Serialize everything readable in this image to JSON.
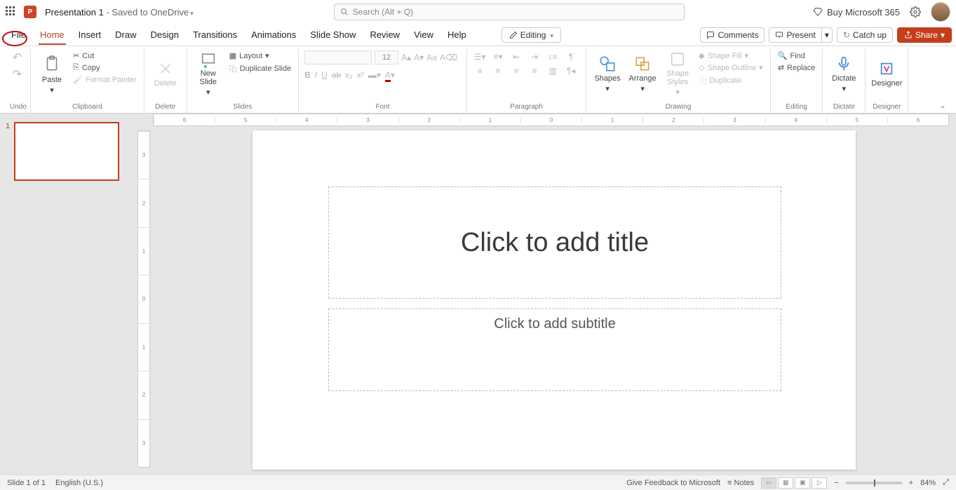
{
  "title": {
    "name": "Presentation 1",
    "suffix": " - Saved to OneDrive"
  },
  "search": {
    "placeholder": "Search (Alt + Q)"
  },
  "header": {
    "buy": "Buy Microsoft 365"
  },
  "tabs": {
    "file": "File",
    "home": "Home",
    "insert": "Insert",
    "draw": "Draw",
    "design": "Design",
    "transitions": "Transitions",
    "animations": "Animations",
    "slideshow": "Slide Show",
    "review": "Review",
    "view": "View",
    "help": "Help"
  },
  "mode": {
    "editing": "Editing",
    "comments": "Comments",
    "present": "Present",
    "catchup": "Catch up",
    "share": "Share"
  },
  "ribbon": {
    "undo": "Undo",
    "clipboard": {
      "paste": "Paste",
      "cut": "Cut",
      "copy": "Copy",
      "format_painter": "Format Painter",
      "label": "Clipboard"
    },
    "delete": {
      "btn": "Delete",
      "label": "Delete"
    },
    "slides": {
      "new": "New\nSlide",
      "layout": "Layout",
      "duplicate": "Duplicate Slide",
      "label": "Slides"
    },
    "font": {
      "size": "12",
      "label": "Font"
    },
    "paragraph": {
      "label": "Paragraph"
    },
    "drawing": {
      "shapes": "Shapes",
      "arrange": "Arrange",
      "styles": "Shape\nStyles",
      "fill": "Shape Fill",
      "outline": "Shape Outline",
      "dup": "Duplicate",
      "label": "Drawing"
    },
    "editing": {
      "find": "Find",
      "replace": "Replace",
      "label": "Editing"
    },
    "dictate": {
      "btn": "Dictate",
      "label": "Dictate"
    },
    "designer": {
      "btn": "Designer",
      "label": "Designer"
    }
  },
  "thumbs": {
    "n1": "1"
  },
  "slide": {
    "title_ph": "Click to add title",
    "sub_ph": "Click to add subtitle"
  },
  "status": {
    "slide": "Slide 1 of 1",
    "lang": "English (U.S.)",
    "feedback": "Give Feedback to Microsoft",
    "notes": "Notes",
    "zoom": "84%",
    "minus": "−",
    "plus": "+"
  },
  "ruler_h": [
    "6",
    "5",
    "4",
    "3",
    "2",
    "1",
    "0",
    "1",
    "2",
    "3",
    "4",
    "5",
    "6"
  ],
  "ruler_v": [
    "3",
    "2",
    "1",
    "0",
    "1",
    "2",
    "3"
  ]
}
